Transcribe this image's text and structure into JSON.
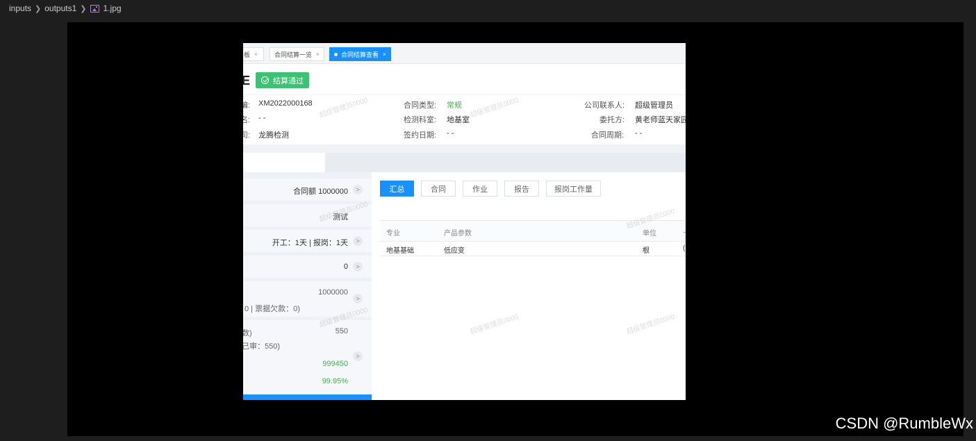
{
  "breadcrumb": {
    "items": [
      "inputs",
      "outputs1",
      "1.jpg"
    ],
    "icon": "image-file-icon"
  },
  "tabs": [
    {
      "label": "板",
      "active": false
    },
    {
      "label": "合同结算一览",
      "active": false
    },
    {
      "label": "合同结算查看",
      "active": true
    }
  ],
  "tab_close": "×",
  "title_fragment": "E",
  "status_badge": "结算通过",
  "info": {
    "row1": {
      "left_label": "编:",
      "left_value": "XM2022000168",
      "mid_label": "合同类型:",
      "mid_value": "常规",
      "right_label": "公司联系人:",
      "right_value": "超级管理员"
    },
    "row2": {
      "left_label": "名:",
      "left_value": "- -",
      "mid_label": "检测科室:",
      "mid_value": "地基室",
      "right_label": "委托方:",
      "right_value": "黄老师蓝天家园"
    },
    "row3": {
      "left_label": "司:",
      "left_value": "龙腾检测",
      "mid_label": "签约日期:",
      "mid_value": "- -",
      "right_label": "合同周期:",
      "right_value": "- -"
    }
  },
  "left_cards": {
    "c1": "合同额 1000000",
    "c2": "测试",
    "c3": "开工：1天 | 报岗：1天",
    "c4": "0",
    "c5_value": "1000000",
    "c5_sub": "0 | 票据欠款：0)",
    "c6_a_label": "数)",
    "c6_a_value": "550",
    "c6_b": "己审：550)",
    "c6_c": "999450",
    "c6_d": "99.95%"
  },
  "arrow_glyph": ">",
  "right_buttons": [
    "汇总",
    "合同",
    "作业",
    "报告",
    "报岗工作量"
  ],
  "table": {
    "headers": [
      "专业",
      "产品参数",
      "单位",
      "十"
    ],
    "rows": [
      [
        "地基基础",
        "低应变",
        "根",
        "("
      ]
    ]
  },
  "watermark": "超级管理员0000",
  "csdn_mark": "CSDN @RumbleWx"
}
